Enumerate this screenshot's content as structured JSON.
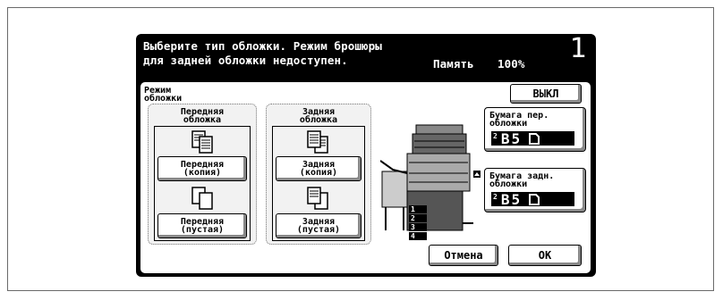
{
  "header": {
    "line1": "Выберите тип обложки. Режим брошюры",
    "line2": "для задней обложки недоступен.",
    "memory_label": "Память",
    "memory_value": "100%",
    "number": "1"
  },
  "mode": {
    "label": "Режим\nобложки",
    "off_button": "ВЫКЛ"
  },
  "front_group": {
    "title": "Передняя\nобложка",
    "copy_button": "Передняя\n(копия)",
    "blank_button": "Передняя\n(пустая)"
  },
  "back_group": {
    "title": "Задняя\nобложка",
    "copy_button": "Задняя\n(копия)",
    "blank_button": "Задняя\n(пустая)"
  },
  "front_paper": {
    "title": "Бумага пер.\nобложки",
    "tray": "2",
    "size": "B5"
  },
  "back_paper": {
    "title": "Бумага задн.\nобложки",
    "tray": "2",
    "size": "B5"
  },
  "machine": {
    "trays": [
      "1",
      "2",
      "3",
      "4"
    ]
  },
  "footer": {
    "cancel_button": "Отмена",
    "ok_button": "OK"
  },
  "colors": {
    "screen": "#000000",
    "panel": "#ffffff",
    "button_shadow": "#888888"
  }
}
